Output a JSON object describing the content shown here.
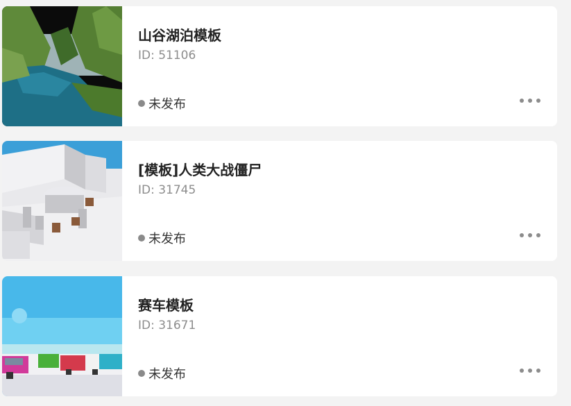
{
  "templates": [
    {
      "title": "山谷湖泊模板",
      "id_text": "ID: 51106",
      "status": "未发布",
      "thumbnail_icon": "voxel-valley-lake-thumbnail",
      "more_icon": "more-horizontal-icon"
    },
    {
      "title": "[模板]人类大战僵尸",
      "id_text": "ID: 31745",
      "status": "未发布",
      "thumbnail_icon": "voxel-room-thumbnail",
      "more_icon": "more-horizontal-icon"
    },
    {
      "title": "赛车模板",
      "id_text": "ID: 31671",
      "status": "未发布",
      "thumbnail_icon": "voxel-racing-cars-thumbnail",
      "more_icon": "more-horizontal-icon"
    }
  ],
  "colors": {
    "page_background": "#f3f3f3",
    "card_background": "#ffffff",
    "title_text": "#222222",
    "id_text": "#8c8c8c",
    "status_dot": "#8a8a8a"
  }
}
